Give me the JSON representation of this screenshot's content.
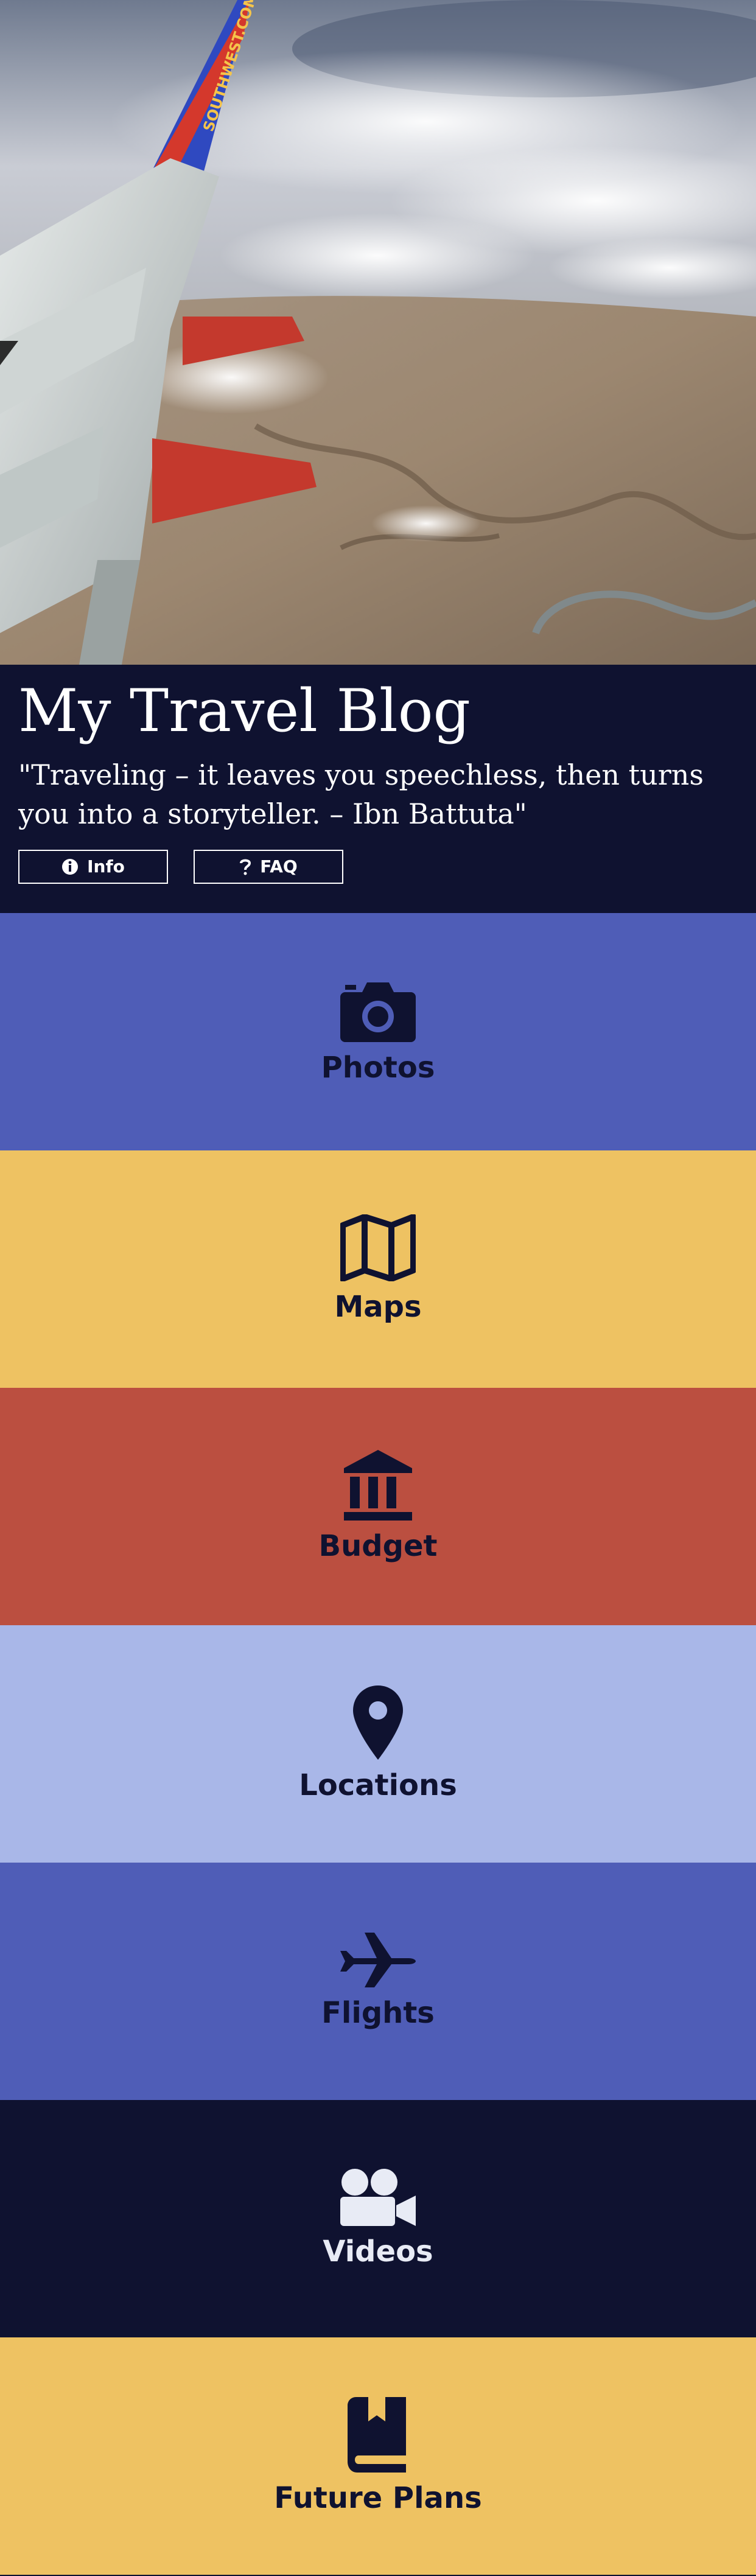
{
  "hero": {
    "alt_icon": "airplane-wing-photo",
    "wing_text": "SOUTHWEST.COM"
  },
  "header": {
    "title": "My Travel Blog",
    "quote": "\"Traveling – it leaves you speechless, then turns you into a storyteller. – Ibn Battuta\"",
    "buttons": [
      {
        "label": "Info",
        "icon": "info-icon"
      },
      {
        "label": "FAQ",
        "icon": "question-icon"
      }
    ]
  },
  "tiles": [
    {
      "label": "Photos",
      "icon": "camera-icon",
      "bg": "#4f5db7",
      "fg": "#0f1230"
    },
    {
      "label": "Maps",
      "icon": "map-icon",
      "bg": "#eec262",
      "fg": "#0f1230"
    },
    {
      "label": "Budget",
      "icon": "bank-icon",
      "bg": "#bb4f40",
      "fg": "#0f1230"
    },
    {
      "label": "Locations",
      "icon": "map-pin-icon",
      "bg": "#a9b7e8",
      "fg": "#0f1230"
    },
    {
      "label": "Flights",
      "icon": "plane-icon",
      "bg": "#4f5db7",
      "fg": "#0f1230"
    },
    {
      "label": "Videos",
      "icon": "video-camera-icon",
      "bg": "#0f1230",
      "fg": "#e8ebf5"
    },
    {
      "label": "Future Plans",
      "icon": "book-icon",
      "bg": "#eec262",
      "fg": "#0f1230"
    }
  ]
}
